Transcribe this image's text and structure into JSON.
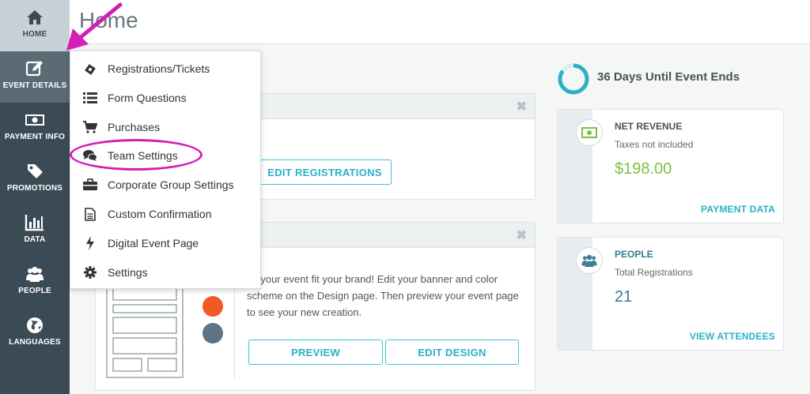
{
  "colors": {
    "sidebar_bg": "#3b4b55",
    "accent": "#2ab1c6",
    "revenue_green": "#7ac143",
    "annotation": "#d31fb3"
  },
  "sidebar": {
    "items": [
      {
        "label": "HOME",
        "icon": "home-icon"
      },
      {
        "label": "EVENT DETAILS",
        "icon": "edit-icon"
      },
      {
        "label": "PAYMENT INFO",
        "icon": "money-icon"
      },
      {
        "label": "PROMOTIONS",
        "icon": "tag-icon"
      },
      {
        "label": "DATA",
        "icon": "bar-chart-icon"
      },
      {
        "label": "PEOPLE",
        "icon": "people-icon"
      },
      {
        "label": "LANGUAGES",
        "icon": "globe-icon"
      }
    ]
  },
  "header": {
    "title": "Home"
  },
  "menu": {
    "items": [
      {
        "label": "Registrations/Tickets",
        "icon": "ticket-icon"
      },
      {
        "label": "Form Questions",
        "icon": "list-icon"
      },
      {
        "label": "Purchases",
        "icon": "cart-icon"
      },
      {
        "label": "Team Settings",
        "icon": "chat-icon"
      },
      {
        "label": "Corporate Group Settings",
        "icon": "briefcase-icon"
      },
      {
        "label": "Custom Confirmation",
        "icon": "document-icon"
      },
      {
        "label": "Digital Event Page",
        "icon": "lightning-icon"
      },
      {
        "label": "Settings",
        "icon": "gear-icon"
      }
    ]
  },
  "registrations_card": {
    "button": "EDIT REGISTRATIONS"
  },
  "design_card": {
    "text": "ke your event fit your brand! Edit your banner and color scheme on the Design page. Then preview your event page to see your new creation.",
    "preview_button": "PREVIEW",
    "edit_button": "EDIT DESIGN",
    "swatches": [
      "#f15a24",
      "#5c7483"
    ]
  },
  "countdown": {
    "text": "36 Days Until Event Ends",
    "progress": 0.85
  },
  "revenue": {
    "title": "NET REVENUE",
    "subtitle": "Taxes not included",
    "value": "$198.00",
    "link": "PAYMENT DATA"
  },
  "people": {
    "title": "PEOPLE",
    "subtitle": "Total Registrations",
    "value": "21",
    "link": "VIEW ATTENDEES"
  }
}
